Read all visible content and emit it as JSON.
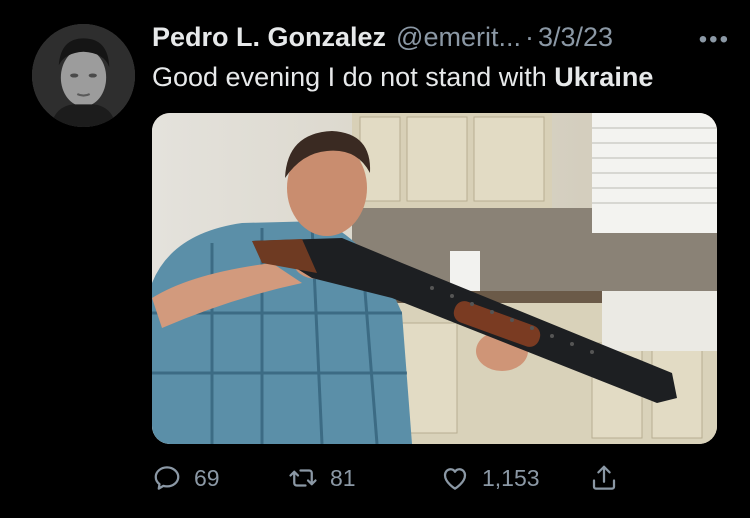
{
  "tweet": {
    "author": {
      "display_name": "Pedro L. Gonzalez",
      "handle": "@emerit...",
      "separator": "·",
      "date": "3/3/23",
      "avatar": "profile-photo"
    },
    "more_icon": "more-horizontal-icon",
    "text": {
      "plain": "Good evening I do not stand with ",
      "bold": "Ukraine"
    },
    "media": {
      "kind": "photo",
      "subject": "man-aiming-shotgun-in-kitchen"
    },
    "actions": {
      "reply": {
        "icon": "reply-icon",
        "count": "69"
      },
      "retweet": {
        "icon": "retweet-icon",
        "count": "81"
      },
      "like": {
        "icon": "heart-icon",
        "count": "1,153"
      },
      "share": {
        "icon": "share-icon"
      }
    },
    "colors": {
      "background": "#000000",
      "primary_text": "#e7e9ea",
      "secondary_text": "#8b98a5"
    }
  }
}
